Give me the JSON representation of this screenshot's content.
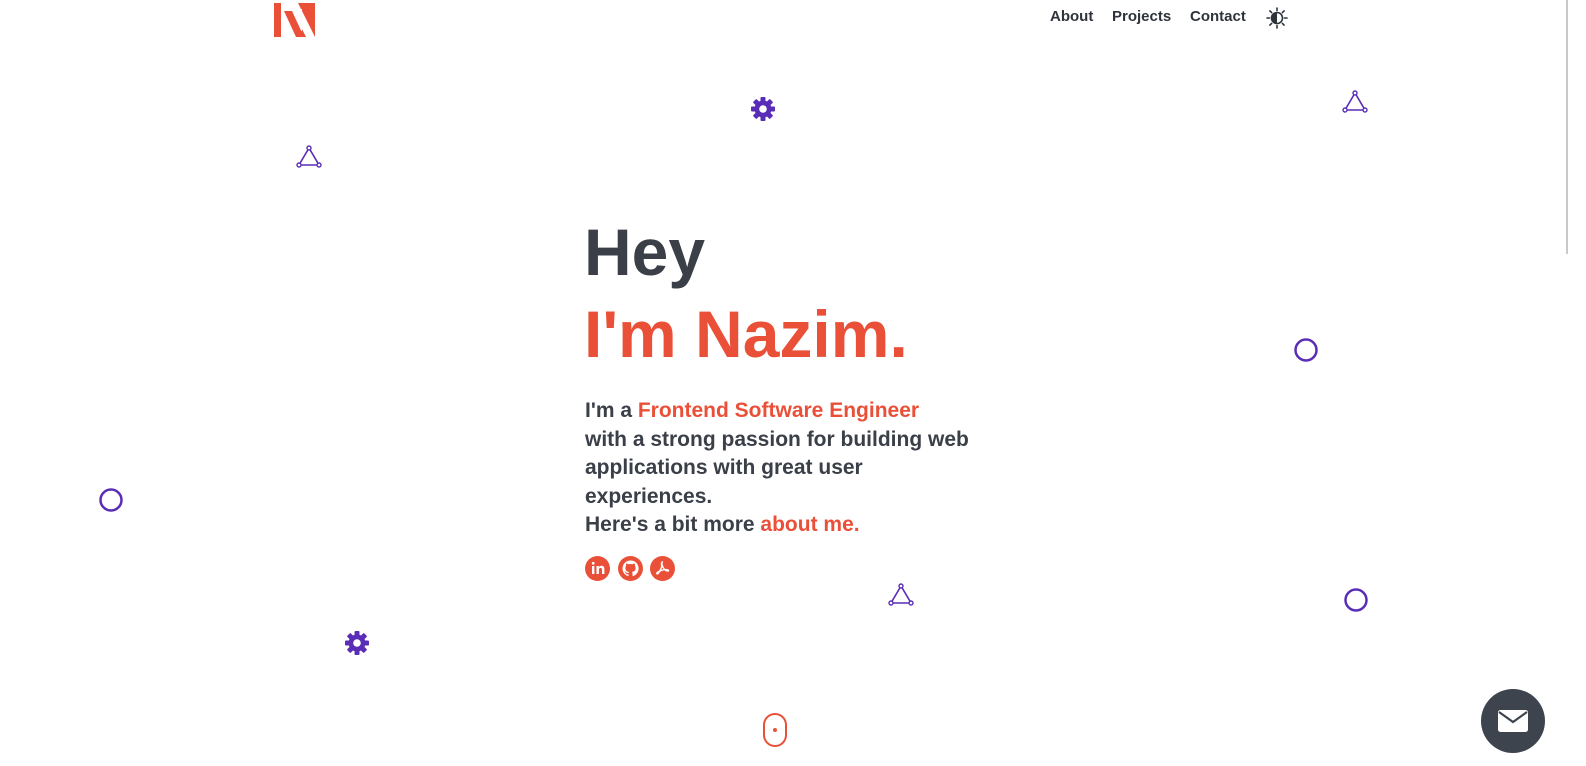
{
  "header": {
    "logo_letter": "N",
    "nav": [
      {
        "label": "About"
      },
      {
        "label": "Projects"
      },
      {
        "label": "Contact"
      }
    ],
    "theme_toggle_icon": "contrast-icon"
  },
  "hero": {
    "greeting": "Hey",
    "name_line": "I'm Nazim.",
    "intro_prefix": "I'm a ",
    "role": "Frontend Software Engineer",
    "intro_body": "with a strong passion for building web applications with great user experiences.",
    "more_prefix": "Here's a bit more ",
    "about_link": "about me."
  },
  "social": [
    {
      "name": "linkedin",
      "icon": "linkedin-icon"
    },
    {
      "name": "github",
      "icon": "github-icon"
    },
    {
      "name": "resume",
      "icon": "acrobat-icon"
    }
  ],
  "decorations": [
    "gear-icon",
    "triangle-icon",
    "circle-icon"
  ],
  "scroll_indicator": "mouse-icon",
  "contact_fab_icon": "mail-icon",
  "colors": {
    "accent": "#ea5038",
    "text": "#3a3f48",
    "decoration": "#5a2db6",
    "fab": "#3e444e",
    "background": "#ffffff"
  }
}
